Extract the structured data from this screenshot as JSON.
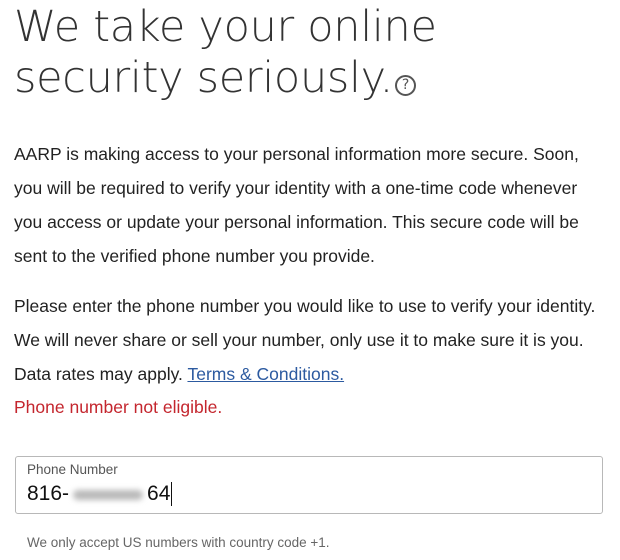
{
  "header": {
    "title_line1": "We take your online",
    "title_line2": "security seriously.",
    "help_icon_glyph": "?"
  },
  "intro": {
    "paragraph1": "AARP is making access to your personal information more secure. Soon, you will be required to verify your identity with a one-time code whenever you access or update your personal information. This secure code will be sent to the verified phone number you provide.",
    "paragraph2": "Please enter the phone number you would like to use to verify your identity. We will never share or sell your number, only use it to make sure it is you. Data rates may apply.",
    "terms_link_label": "Terms & Conditions."
  },
  "error": {
    "message": "Phone number not eligible.",
    "color": "#c4262e"
  },
  "phone_field": {
    "label": "Phone Number",
    "value_prefix": "816-",
    "value_suffix": "64",
    "value_obscured": true
  },
  "hint": {
    "text": "We only accept US numbers with country code +1."
  },
  "colors": {
    "link": "#2c5aa0",
    "text": "#222222",
    "field_border": "#b8b8b8"
  }
}
